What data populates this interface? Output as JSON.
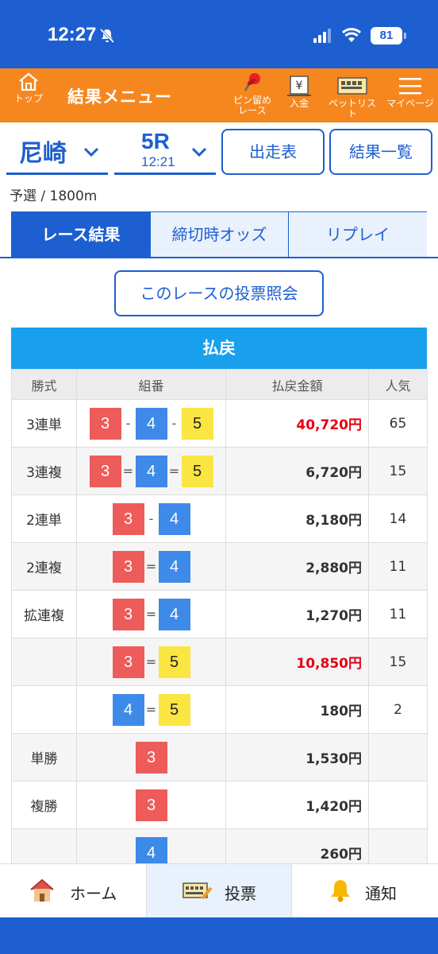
{
  "status": {
    "time": "12:27",
    "battery": "81"
  },
  "header": {
    "top_label": "トップ",
    "title": "結果メニュー",
    "pin_label_1": "ピン留め",
    "pin_label_2": "レース",
    "deposit_label": "入金",
    "betlist_label": "ベットリスト",
    "mypage_label": "マイページ"
  },
  "selectors": {
    "venue": "尼崎",
    "race": "5R",
    "race_time": "12:21",
    "entries_button": "出走表",
    "results_button": "結果一覧"
  },
  "race_info": "予選 / 1800m",
  "tabs": [
    {
      "label": "レース結果",
      "active": true
    },
    {
      "label": "締切時オッズ",
      "active": false
    },
    {
      "label": "リプレイ",
      "active": false
    }
  ],
  "vote_query_button": "このレースの投票照会",
  "payout": {
    "title": "払戻",
    "columns": [
      "勝式",
      "組番",
      "払戻金額",
      "人気"
    ],
    "rows": [
      {
        "type": "3連単",
        "boats": [
          "3",
          "4",
          "5"
        ],
        "sep": "-",
        "amount": "40,720円",
        "popularity": "65",
        "highlight": true
      },
      {
        "type": "3連複",
        "boats": [
          "3",
          "4",
          "5"
        ],
        "sep": "=",
        "amount": "6,720円",
        "popularity": "15",
        "highlight": false
      },
      {
        "type": "2連単",
        "boats": [
          "3",
          "4"
        ],
        "sep": "-",
        "amount": "8,180円",
        "popularity": "14",
        "highlight": false
      },
      {
        "type": "2連複",
        "boats": [
          "3",
          "4"
        ],
        "sep": "=",
        "amount": "2,880円",
        "popularity": "11",
        "highlight": false
      },
      {
        "type": "拡連複",
        "boats": [
          "3",
          "4"
        ],
        "sep": "=",
        "amount": "1,270円",
        "popularity": "11",
        "highlight": false
      },
      {
        "type": "",
        "boats": [
          "3",
          "5"
        ],
        "sep": "=",
        "amount": "10,850円",
        "popularity": "15",
        "highlight": true
      },
      {
        "type": "",
        "boats": [
          "4",
          "5"
        ],
        "sep": "=",
        "amount": "180円",
        "popularity": "2",
        "highlight": false
      },
      {
        "type": "単勝",
        "boats": [
          "3"
        ],
        "sep": "",
        "amount": "1,530円",
        "popularity": "",
        "highlight": false
      },
      {
        "type": "複勝",
        "boats": [
          "3"
        ],
        "sep": "",
        "amount": "1,420円",
        "popularity": "",
        "highlight": false
      },
      {
        "type": "",
        "boats": [
          "4"
        ],
        "sep": "",
        "amount": "260円",
        "popularity": "",
        "highlight": false
      }
    ]
  },
  "bottom_nav": {
    "home": "ホーム",
    "vote": "投票",
    "notify": "通知"
  },
  "colors": {
    "primary": "#1d5fd0",
    "header_orange": "#f6871f",
    "payout_blue": "#18a0ec",
    "red": "#e60012",
    "boat3": "#ee5b5b",
    "boat4": "#3e8ae8",
    "boat5": "#fbe543"
  }
}
